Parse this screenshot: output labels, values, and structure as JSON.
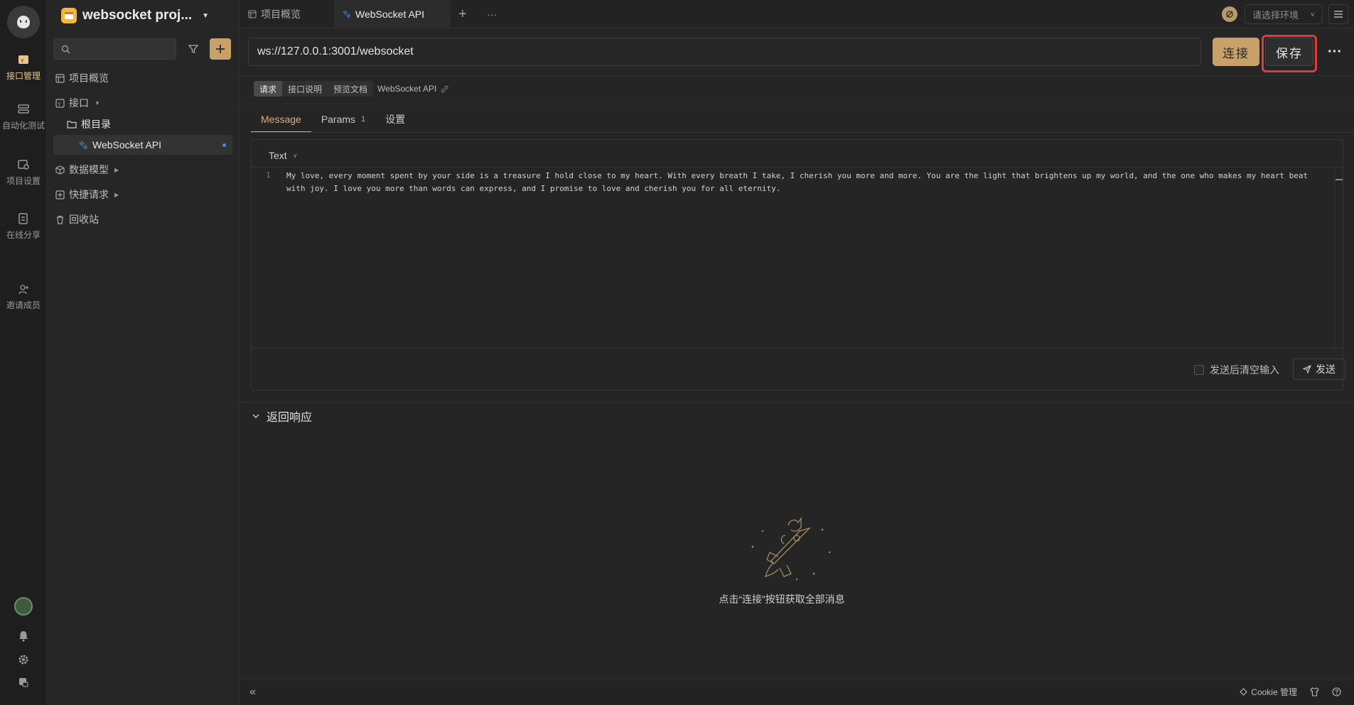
{
  "rail": {
    "items": [
      {
        "label": "接口管理",
        "icon": "api-management-icon"
      },
      {
        "label": "自动化测试",
        "icon": "automation-icon"
      },
      {
        "label": "项目设置",
        "icon": "project-settings-icon"
      },
      {
        "label": "在线分享",
        "icon": "share-icon"
      },
      {
        "label": "邀请成员",
        "icon": "invite-icon"
      }
    ]
  },
  "sidebar": {
    "project_name": "websocket proj...",
    "search_placeholder": "",
    "tree": {
      "overview": "项目概览",
      "interface": "接口",
      "root_dir": "根目录",
      "ws_api": "WebSocket API",
      "data_model": "数据模型",
      "quick_request": "快捷请求",
      "recycle_bin": "回收站"
    }
  },
  "tabs": {
    "overview": "项目概览",
    "active": "WebSocket API",
    "add": "+",
    "more": "···"
  },
  "env": {
    "placeholder": "请选择环境"
  },
  "request": {
    "url": "ws://127.0.0.1:3001/websocket",
    "connect_label": "连接",
    "save_label": "保存",
    "more_label": "···"
  },
  "subtabs": {
    "request": "请求",
    "doc": "接口说明",
    "preview": "预览文档",
    "api_name": "WebSocket API"
  },
  "message_tabs": {
    "message": "Message",
    "params": "Params",
    "params_count": "1",
    "settings": "设置"
  },
  "editor": {
    "format": "Text",
    "line_number": "1",
    "content": "My love, every moment spent by your side is a treasure I hold close to my heart. With every breath I take, I cherish you more and more. You are the light that brightens up my world, and the one who makes my heart beat with joy. I love you more than words can express, and I promise to love and cherish you for all eternity.",
    "clear_after_send": "发送后清空输入",
    "send_label": "发送"
  },
  "response": {
    "title": "返回响应",
    "empty_text": "点击“连接”按钮获取全部消息"
  },
  "status": {
    "cookie": "Cookie 管理"
  },
  "colors": {
    "accent": "#c7a06a",
    "highlight_border": "#e03a3a",
    "background": "#252525"
  }
}
